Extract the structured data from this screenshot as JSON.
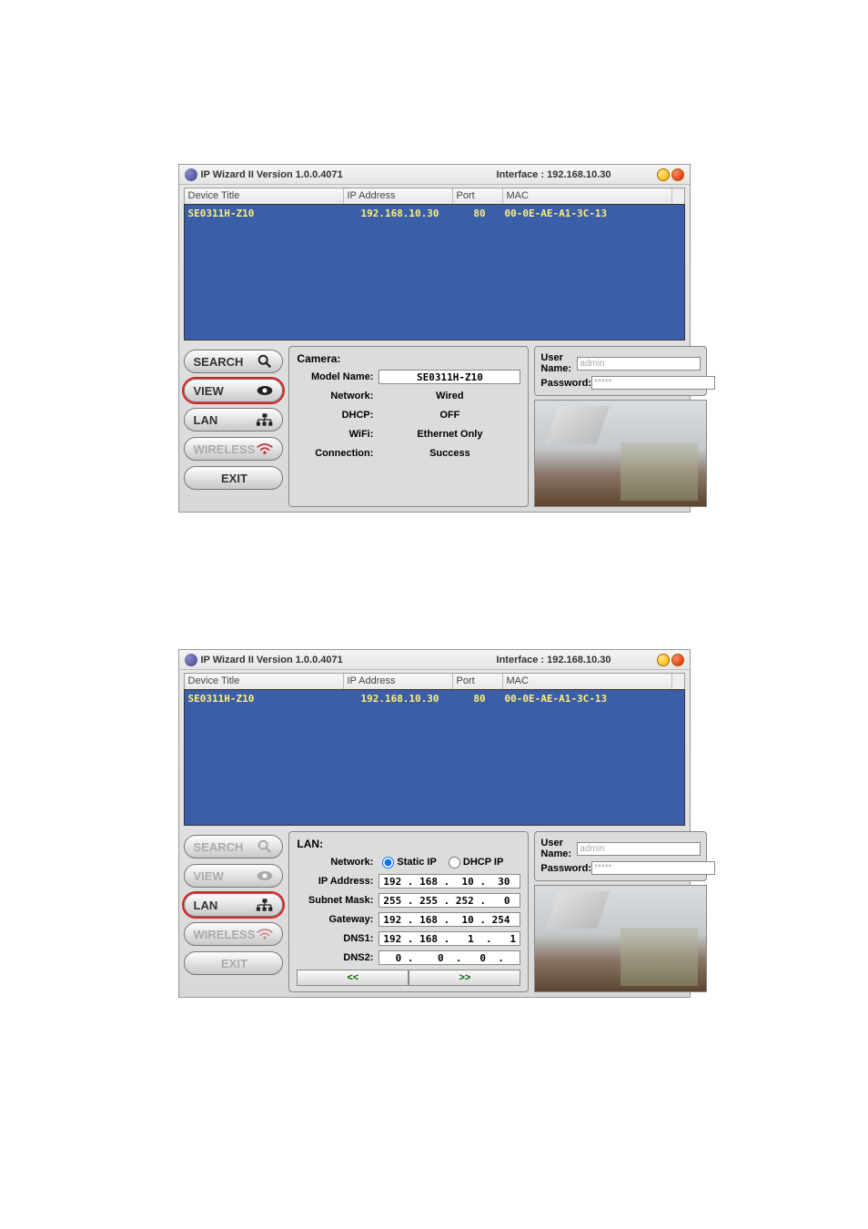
{
  "app_title": "IP Wizard II  Version 1.0.0.4071",
  "interface_label": "Interface : 192.168.10.30",
  "columns": {
    "device": "Device Title",
    "ip": "IP Address",
    "port": "Port",
    "mac": "MAC"
  },
  "device_row": {
    "title": "SE0311H-Z10",
    "ip": "192.168.10.30",
    "port": "80",
    "mac": "00-0E-AE-A1-3C-13"
  },
  "sidebar": {
    "search": "SEARCH",
    "view": "VIEW",
    "lan": "LAN",
    "wireless": "WIRELESS",
    "exit": "EXIT"
  },
  "creds": {
    "user_label": "User Name:",
    "user_val": "admin",
    "pass_label": "Password:",
    "pass_val": "*****"
  },
  "window1": {
    "panel_title": "Camera:",
    "model_label": "Model Name:",
    "model_val": "SE0311H-Z10",
    "network_label": "Network:",
    "network_val": "Wired",
    "dhcp_label": "DHCP:",
    "dhcp_val": "OFF",
    "wifi_label": "WiFi:",
    "wifi_val": "Ethernet Only",
    "conn_label": "Connection:",
    "conn_val": "Success"
  },
  "window2": {
    "panel_title": "LAN:",
    "network_label": "Network:",
    "static_label": "Static IP",
    "dhcp_label": "DHCP IP",
    "ip_label": "IP Address:",
    "ip_val": "192 . 168 .  10 .  30",
    "mask_label": "Subnet Mask:",
    "mask_val": "255 . 255 . 252 .   0",
    "gw_label": "Gateway:",
    "gw_val": "192 . 168 .  10 . 254",
    "dns1_label": "DNS1:",
    "dns1_val": "192 . 168 .   1  .   1",
    "dns2_label": "DNS2:",
    "dns2_val": "  0 .    0  .   0  .   0",
    "prev": "<<",
    "next": ">>"
  }
}
